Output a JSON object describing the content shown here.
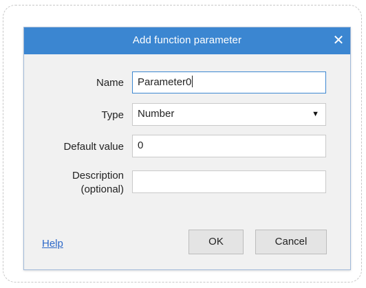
{
  "dialog": {
    "title": "Add function parameter",
    "close_symbol": "✕"
  },
  "fields": {
    "name": {
      "label": "Name",
      "value": "Parameter0"
    },
    "type": {
      "label": "Type",
      "value": "Number",
      "arrow": "▼"
    },
    "default_value": {
      "label": "Default value",
      "value": "0"
    },
    "description": {
      "label_line1": "Description",
      "label_line2": "(optional)",
      "value": ""
    }
  },
  "footer": {
    "help_label": "Help",
    "ok_label": "OK",
    "cancel_label": "Cancel"
  },
  "colors": {
    "titlebar": "#3b86d1",
    "link": "#2c68c8"
  },
  "icons": {
    "close": "close-icon",
    "dropdown": "chevron-down-icon"
  }
}
